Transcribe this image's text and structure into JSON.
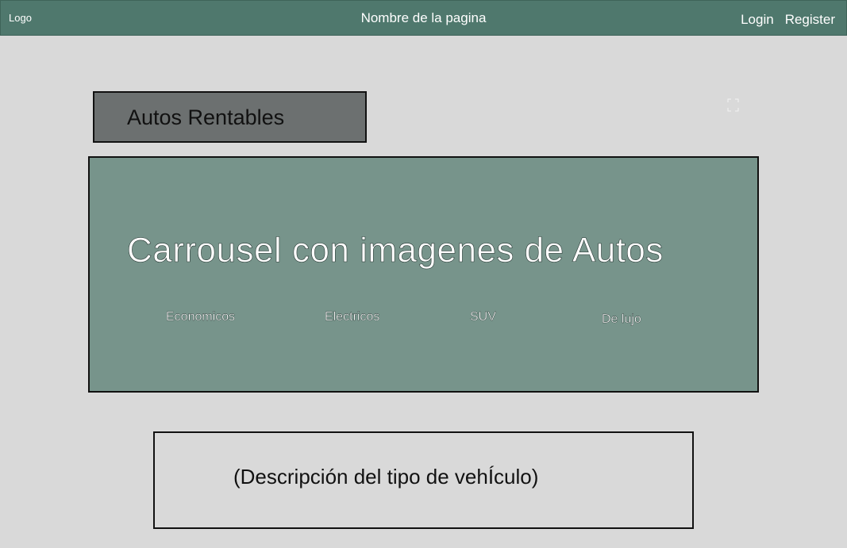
{
  "header": {
    "logo": "Logo",
    "site_name": "Nombre de la pagina",
    "login": "Login",
    "register": "Register"
  },
  "section": {
    "title": "Autos Rentables"
  },
  "carousel": {
    "title": "Carrousel con imagenes de Autos",
    "categories": [
      "Economicos",
      "Electricos",
      "SUV",
      "De lujo"
    ]
  },
  "description": {
    "text": "(Descripción del tipo de vehÍculo)"
  },
  "colors": {
    "header_bg": "#4f786d",
    "page_bg": "#d9d9d9",
    "title_box_bg": "#6c7070",
    "carousel_bg": "#77948b"
  }
}
